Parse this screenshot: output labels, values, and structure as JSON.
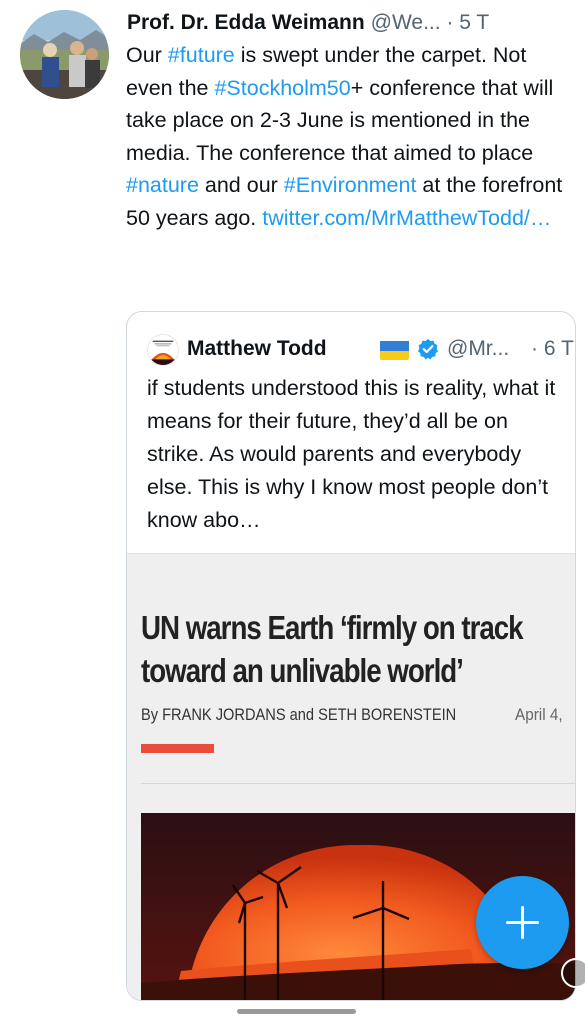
{
  "tweet": {
    "author_name": "Prof. Dr. Edda Weimann",
    "author_handle": "@We...",
    "time": "· 5 T",
    "text_parts": [
      {
        "text": "Our ",
        "link": false
      },
      {
        "text": "#future",
        "link": true
      },
      {
        "text": " is swept under the carpet. Not even the ",
        "link": false
      },
      {
        "text": "#Stockholm50",
        "link": true
      },
      {
        "text": "+ conference that will take place on 2-3 June is mentioned in the media. The conference that aimed to place ",
        "link": false
      },
      {
        "text": "#nature",
        "link": true
      },
      {
        "text": " and our ",
        "link": false
      },
      {
        "text": "#Environment",
        "link": true
      },
      {
        "text": " at the forefront 50 years ago. ",
        "link": false
      },
      {
        "text": "twitter.com/​MrMatthewTodd/…",
        "link": true
      }
    ]
  },
  "quoted_tweet": {
    "author_name": "Matthew Todd",
    "flag_icon": "ukraine-flag-icon",
    "verified_icon": "verified-badge-icon",
    "author_handle": "@Mr...",
    "time": "· 6 T",
    "text": "if students understood this is reality, what it means for their future, they’d all be on strike. As would parents and everybody else. This is why I know most people don’t know abo…"
  },
  "article": {
    "title_line1": "UN warns Earth ‘firmly on track",
    "title_line2": "toward an unlivable world’",
    "byline": "By FRANK JORDANS and SETH BORENSTEIN",
    "date": "April 4,"
  },
  "fab": {
    "icon": "plus-icon"
  },
  "colors": {
    "link": "#1d9bf0",
    "accent_bar": "#ec4b3c",
    "fab": "#1d9bf0"
  }
}
